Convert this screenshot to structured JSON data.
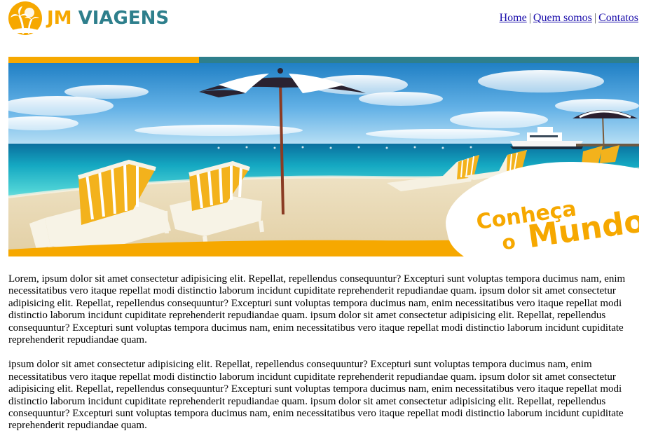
{
  "header": {
    "logo": {
      "brand_first": "JM",
      "brand_second": "VIAGENS",
      "icon": "palm-tree-sun-icon",
      "colors": {
        "orange": "#f6a800",
        "teal": "#2e7f8c"
      }
    },
    "nav": {
      "items": [
        {
          "label": "Home"
        },
        {
          "label": "Quem somos"
        },
        {
          "label": "Contatos"
        }
      ],
      "separator": "|"
    }
  },
  "banner": {
    "tagline_line1": "Conheça",
    "tagline_line2_small": "o",
    "tagline_line2_big": "Mundo",
    "colors": {
      "top_bar_orange": "#f6a800",
      "top_bar_teal": "#2e7f8c",
      "tagline": "#f6a800"
    }
  },
  "content": {
    "paragraphs": [
      "Lorem, ipsum dolor sit amet consectetur adipisicing elit. Repellat, repellendus consequuntur? Excepturi sunt voluptas tempora ducimus nam, enim necessitatibus vero itaque repellat modi distinctio laborum incidunt cupiditate reprehenderit repudiandae quam. ipsum dolor sit amet consectetur adipisicing elit. Repellat, repellendus consequuntur? Excepturi sunt voluptas tempora ducimus nam, enim necessitatibus vero itaque repellat modi distinctio laborum incidunt cupiditate reprehenderit repudiandae quam. ipsum dolor sit amet consectetur adipisicing elit. Repellat, repellendus consequuntur? Excepturi sunt voluptas tempora ducimus nam, enim necessitatibus vero itaque repellat modi distinctio laborum incidunt cupiditate reprehenderit repudiandae quam.",
      "ipsum dolor sit amet consectetur adipisicing elit. Repellat, repellendus consequuntur? Excepturi sunt voluptas tempora ducimus nam, enim necessitatibus vero itaque repellat modi distinctio laborum incidunt cupiditate reprehenderit repudiandae quam. ipsum dolor sit amet consectetur adipisicing elit. Repellat, repellendus consequuntur? Excepturi sunt voluptas tempora ducimus nam, enim necessitatibus vero itaque repellat modi distinctio laborum incidunt cupiditate reprehenderit repudiandae quam. ipsum dolor sit amet consectetur adipisicing elit. Repellat, repellendus consequuntur? Excepturi sunt voluptas tempora ducimus nam, enim necessitatibus vero itaque repellat modi distinctio laborum incidunt cupiditate reprehenderit repudiandae quam."
    ]
  }
}
